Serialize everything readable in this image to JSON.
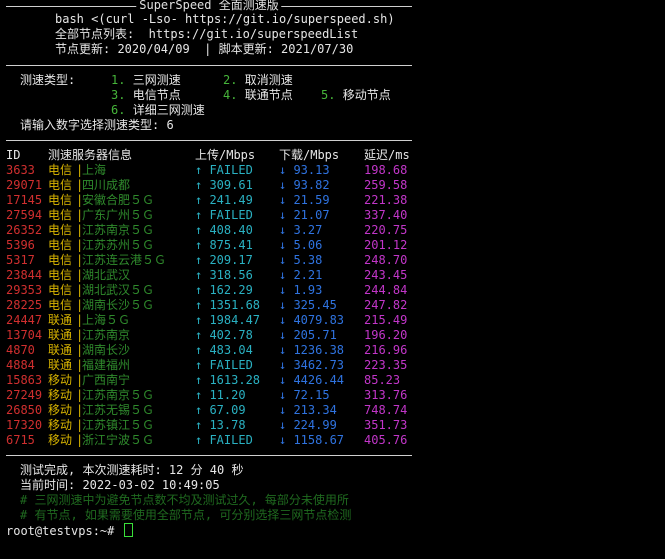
{
  "header": {
    "title": "SuperSpeed 全面测速版",
    "cmd": "bash <(curl -Lso- https://git.io/superspeed.sh)",
    "list_line": "全部节点列表:  https://git.io/superspeedList",
    "update_line": "节点更新: 2020/04/09  | 脚本更新: 2021/07/30"
  },
  "menu": {
    "label": "测速类型:",
    "options": [
      {
        "num": "1.",
        "label": "三网测速"
      },
      {
        "num": "2.",
        "label": "取消测速"
      },
      {
        "num": "3.",
        "label": "电信节点"
      },
      {
        "num": "4.",
        "label": "联通节点"
      },
      {
        "num": "5.",
        "label": "移动节点"
      },
      {
        "num": "6.",
        "label": "详细三网测速"
      }
    ],
    "prompt": "请输入数字选择测速类型: 6"
  },
  "table": {
    "columns": [
      "ID",
      "测速服务器信息",
      "上传/Mbps",
      "下载/Mbps",
      "延迟/ms"
    ],
    "rows": [
      {
        "id": "3633",
        "isp": "电信",
        "loc": "上海",
        "up": "↑ FAILED",
        "down": "↓ 93.13",
        "lat": "198.68"
      },
      {
        "id": "29071",
        "isp": "电信",
        "loc": "四川成都",
        "up": "↑ 309.61",
        "down": "↓ 93.82",
        "lat": "259.58"
      },
      {
        "id": "17145",
        "isp": "电信",
        "loc": "安徽合肥５Ｇ",
        "up": "↑ 241.49",
        "down": "↓ 21.59",
        "lat": "221.38"
      },
      {
        "id": "27594",
        "isp": "电信",
        "loc": "广东广州５Ｇ",
        "up": "↑ FAILED",
        "down": "↓ 21.07",
        "lat": "337.40"
      },
      {
        "id": "26352",
        "isp": "电信",
        "loc": "江苏南京５Ｇ",
        "up": "↑ 408.40",
        "down": "↓ 3.27",
        "lat": "220.75"
      },
      {
        "id": "5396",
        "isp": "电信",
        "loc": "江苏苏州５Ｇ",
        "up": "↑ 875.41",
        "down": "↓ 5.06",
        "lat": "201.12"
      },
      {
        "id": "5317",
        "isp": "电信",
        "loc": "江苏连云港５Ｇ",
        "up": "↑ 209.17",
        "down": "↓ 5.38",
        "lat": "248.70"
      },
      {
        "id": "23844",
        "isp": "电信",
        "loc": "湖北武汉",
        "up": "↑ 318.56",
        "down": "↓ 2.21",
        "lat": "243.45"
      },
      {
        "id": "29353",
        "isp": "电信",
        "loc": "湖北武汉５Ｇ",
        "up": "↑ 162.29",
        "down": "↓ 1.93",
        "lat": "244.84"
      },
      {
        "id": "28225",
        "isp": "电信",
        "loc": "湖南长沙５Ｇ",
        "up": "↑ 1351.68",
        "down": "↓ 325.45",
        "lat": "247.82"
      },
      {
        "id": "24447",
        "isp": "联通",
        "loc": "上海５Ｇ",
        "up": "↑ 1984.47",
        "down": "↓ 4079.83",
        "lat": "215.49"
      },
      {
        "id": "13704",
        "isp": "联通",
        "loc": "江苏南京",
        "up": "↑ 402.78",
        "down": "↓ 205.71",
        "lat": "196.20"
      },
      {
        "id": "4870",
        "isp": "联通",
        "loc": "湖南长沙",
        "up": "↑ 483.04",
        "down": "↓ 1236.38",
        "lat": "216.96"
      },
      {
        "id": "4884",
        "isp": "联通",
        "loc": "福建福州",
        "up": "↑ FAILED",
        "down": "↓ 3462.73",
        "lat": "223.35"
      },
      {
        "id": "15863",
        "isp": "移动",
        "loc": "广西南宁",
        "up": "↑ 1613.28",
        "down": "↓ 4426.44",
        "lat": "85.23"
      },
      {
        "id": "27249",
        "isp": "移动",
        "loc": "江苏南京５Ｇ",
        "up": "↑ 11.20",
        "down": "↓ 72.15",
        "lat": "313.76"
      },
      {
        "id": "26850",
        "isp": "移动",
        "loc": "江苏无锡５Ｇ",
        "up": "↑ 67.09",
        "down": "↓ 213.34",
        "lat": "748.74"
      },
      {
        "id": "17320",
        "isp": "移动",
        "loc": "江苏镇江５Ｇ",
        "up": "↑ 13.78",
        "down": "↓ 224.99",
        "lat": "351.73"
      },
      {
        "id": "6715",
        "isp": "移动",
        "loc": "浙江宁波５Ｇ",
        "up": "↑ FAILED",
        "down": "↓ 1158.67",
        "lat": "405.76"
      }
    ]
  },
  "footer": {
    "done_line": "测试完成, 本次测速耗时: 12 分 40 秒",
    "time_line": "当前时间: 2022-03-02 10:49:05",
    "note1": "# 三网测速中为避免节点数不均及测试过久, 每部分未使用所",
    "note2": "# 有节点, 如果需要使用全部节点, 可分别选择三网节点检测"
  },
  "prompt": {
    "text": "root@testvps:~# "
  }
}
